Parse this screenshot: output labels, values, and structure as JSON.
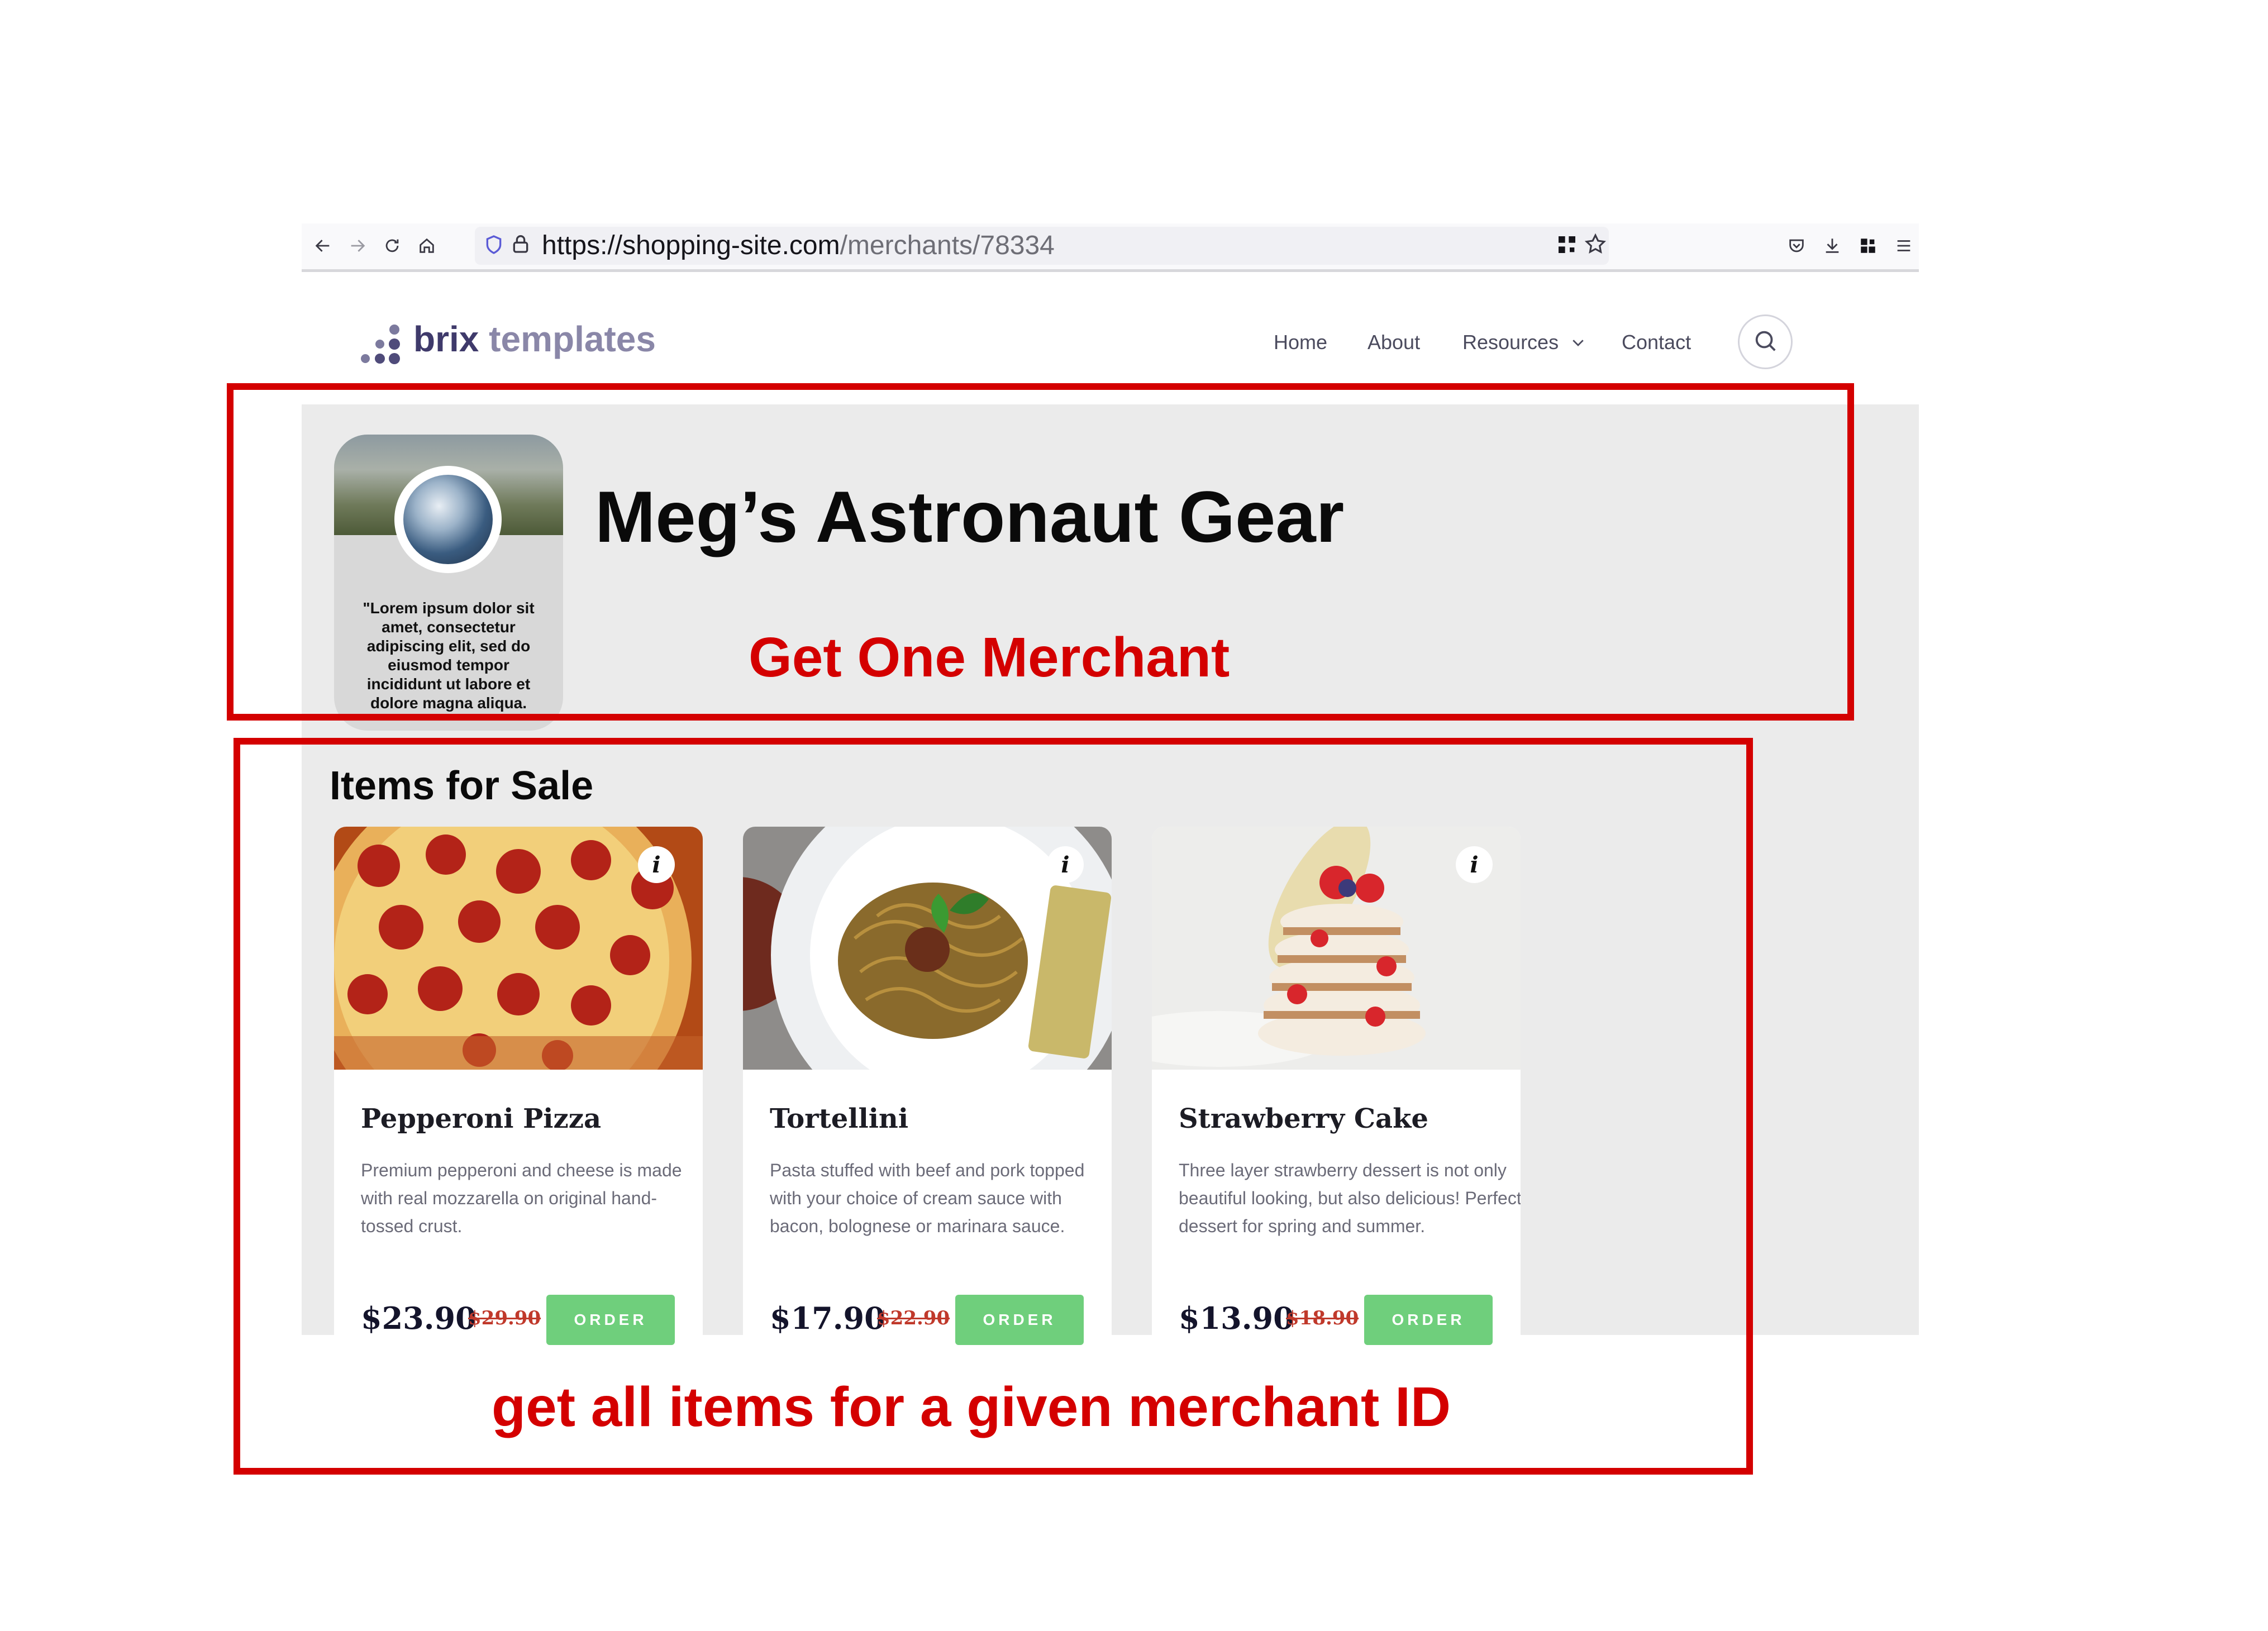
{
  "browser": {
    "url_host": "https://shopping-site.com",
    "url_path": "/merchants/78334"
  },
  "site": {
    "logo_word1": "brix",
    "logo_word2": "templates",
    "nav": [
      "Home",
      "About",
      "Resources",
      "Contact"
    ]
  },
  "merchant": {
    "name": "Meg’s Astronaut Gear",
    "bio": "\"Lorem ipsum dolor sit amet, consectetur adipiscing elit, sed do eiusmod tempor incididunt ut labore et dolore magna aliqua."
  },
  "items_heading": "Items for Sale",
  "items": [
    {
      "title": "Pepperoni Pizza",
      "description": "Premium pepperoni and cheese is made with real mozzarella on original hand-tossed crust.",
      "price": "$23.90",
      "old_price": "$29.90",
      "order_label": "ORDER"
    },
    {
      "title": "Tortellini",
      "description": "Pasta stuffed with beef and pork topped with your choice of cream sauce with bacon, bolognese or marinara sauce.",
      "price": "$17.90",
      "old_price": "$22.90",
      "order_label": "ORDER"
    },
    {
      "title": "Strawberry Cake",
      "description": "Three layer strawberry dessert is not only beautiful looking, but also delicious! Perfect dessert for spring and summer.",
      "price": "$13.90",
      "old_price": "$18.90",
      "order_label": "ORDER"
    }
  ],
  "annotations": {
    "merchant_label": "Get One Merchant",
    "items_label": "get all items for a given merchant ID"
  },
  "colors": {
    "annotation_red": "#d40000",
    "order_green": "#6fcf7c",
    "old_price_red": "#c0392b"
  },
  "icons": [
    "back-icon",
    "forward-icon",
    "reload-icon",
    "home-icon",
    "shield-icon",
    "lock-icon",
    "qr-icon",
    "star-icon",
    "pocket-icon",
    "download-icon",
    "extensions-icon",
    "menu-icon",
    "search-icon",
    "chevron-down-icon",
    "info-icon"
  ]
}
